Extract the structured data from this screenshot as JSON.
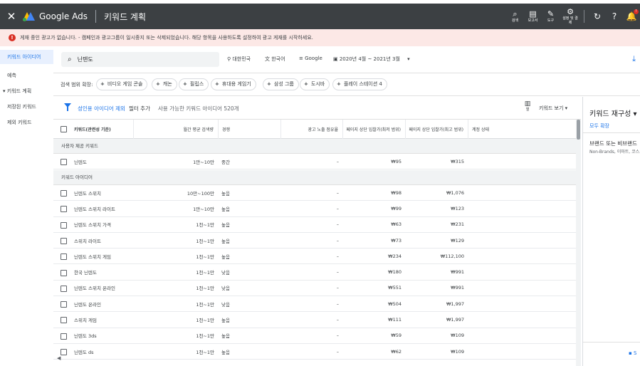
{
  "topbar": {
    "close": "✕",
    "brand": "Google Ads",
    "page_title": "키워드 계획",
    "tools": [
      {
        "icon": "search-icon",
        "label": "검색"
      },
      {
        "icon": "reports-icon",
        "label": "보고서"
      },
      {
        "icon": "tools-icon",
        "label": "도구"
      },
      {
        "icon": "gear-icon",
        "label": "설정 및 결제"
      }
    ],
    "notification_count": "!"
  },
  "alert": {
    "text": "게재 중인 광고가 없습니다. - 캠페인과 광고그룹이 일시중지 또는 삭제되었습니다. 해당 항목을 사용하도록 설정하여 광고 게재를 시작하세요."
  },
  "sidebar": {
    "items": [
      {
        "label": "키워드 아이디어",
        "active": true
      },
      {
        "label": "예측"
      },
      {
        "label": "▾ 키워드 계획"
      },
      {
        "label": "저장된 키워드"
      },
      {
        "label": "제외 키워드"
      }
    ]
  },
  "search": {
    "query": "닌텐도",
    "location": "대한민국",
    "language": "한국어",
    "network": "Google",
    "date_range": "2020년 4월 ~ 2021년 3월"
  },
  "chips": {
    "label": "검색 범위 확장:",
    "items": [
      "비디오 게임 콘솔",
      "캐논",
      "필립스",
      "휴대용 게임기",
      "삼성 그룹",
      "도시바",
      "플레이 스테이션 4"
    ]
  },
  "filter": {
    "adult_exclusion": "성인용 아이디어 제외",
    "add_filter": "필터 추가",
    "count_text": "사용 가능한 키워드 아이디어 520개",
    "columns_label": "열",
    "view_label": "키워드 보기"
  },
  "table": {
    "headers": {
      "keyword": "키워드(관련성 기준)",
      "avg_searches": "월간 평균 검색량",
      "competition": "경쟁",
      "impr_share": "광고 노출 점유율",
      "top_bid_low": "페이지 상단 입찰가(최저 범위)",
      "top_bid_high": "페이지 상단 입찰가(최고 범위)",
      "account_status": "계정 상태"
    },
    "provided_section": "사용자 제공 키워드",
    "provided_rows": [
      {
        "keyword": "닌텐도",
        "searches": "1만~10만",
        "competition": "중간",
        "share": "–",
        "low": "₩95",
        "high": "₩315"
      }
    ],
    "ideas_section": "키워드 아이디어",
    "idea_rows": [
      {
        "keyword": "닌텐도 스위치",
        "searches": "10만~100만",
        "competition": "높음",
        "share": "–",
        "low": "₩98",
        "high": "₩1,076"
      },
      {
        "keyword": "닌텐도 스위치 라이트",
        "searches": "1만~10만",
        "competition": "높음",
        "share": "–",
        "low": "₩99",
        "high": "₩123"
      },
      {
        "keyword": "닌텐도 스위치 가격",
        "searches": "1천~1만",
        "competition": "높음",
        "share": "–",
        "low": "₩63",
        "high": "₩231"
      },
      {
        "keyword": "스위치 라이트",
        "searches": "1천~1만",
        "competition": "높음",
        "share": "–",
        "low": "₩73",
        "high": "₩129"
      },
      {
        "keyword": "닌텐도 스위치 게임",
        "searches": "1천~1만",
        "competition": "높음",
        "share": "–",
        "low": "₩234",
        "high": "₩112,100"
      },
      {
        "keyword": "한국 닌텐도",
        "searches": "1천~1만",
        "competition": "낮음",
        "share": "–",
        "low": "₩180",
        "high": "₩991"
      },
      {
        "keyword": "닌텐도 스위치 온라인",
        "searches": "1천~1만",
        "competition": "낮음",
        "share": "–",
        "low": "₩551",
        "high": "₩991"
      },
      {
        "keyword": "닌텐도 온라인",
        "searches": "1천~1만",
        "competition": "낮음",
        "share": "–",
        "low": "₩504",
        "high": "₩1,997"
      },
      {
        "keyword": "스위치 게임",
        "searches": "1천~1만",
        "competition": "높음",
        "share": "–",
        "low": "₩111",
        "high": "₩1,997"
      },
      {
        "keyword": "닌텐도 3ds",
        "searches": "1천~1만",
        "competition": "높음",
        "share": "–",
        "low": "₩59",
        "high": "₩109"
      },
      {
        "keyword": "닌텐도 ds",
        "searches": "1천~1만",
        "competition": "높음",
        "share": "–",
        "low": "₩62",
        "high": "₩109"
      }
    ]
  },
  "right_panel": {
    "title": "키워드 재구성 ▾",
    "expand_all": "모두 확장",
    "group_title": "브랜드 또는 비브랜드",
    "group_sub": "Non-Brands, 이마트, 코스트코",
    "feedback": "S"
  },
  "colors": {
    "accent": "#1a73e8",
    "topbar": "#3c4043",
    "alert_bg": "#fce8e6",
    "alert_icon": "#d93025"
  }
}
